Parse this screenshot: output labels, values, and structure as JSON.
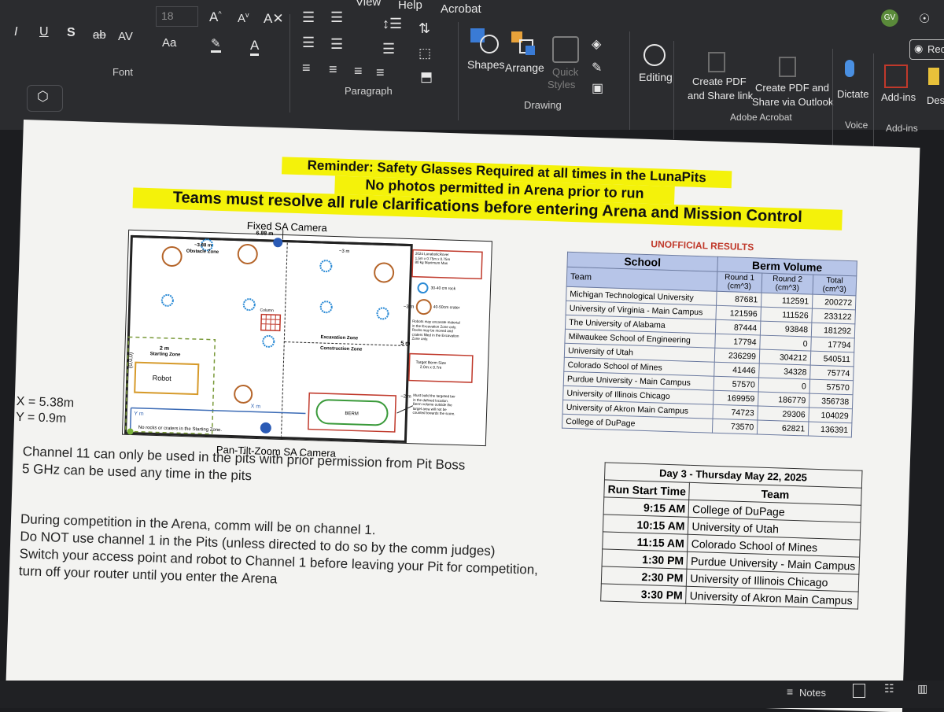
{
  "ribbon": {
    "font_size": "18",
    "menu_tabs": [
      "View",
      "Help",
      "Acrobat"
    ],
    "user_initials": "GV",
    "record_label": "Reco",
    "groups": {
      "font": "Font",
      "paragraph": "Paragraph",
      "drawing": "Drawing",
      "adobe": "Adobe Acrobat",
      "voice": "Voice",
      "addins": "Add-ins"
    },
    "buttons": {
      "shapes": "Shapes",
      "arrange": "Arrange",
      "quick_styles_1": "Quick",
      "quick_styles_2": "Styles",
      "editing": "Editing",
      "create_pdf_1": "Create PDF",
      "create_pdf_2": "and Share link",
      "create_pdf_outlook_1": "Create PDF and",
      "create_pdf_outlook_2": "Share via Outlook",
      "dictate": "Dictate",
      "addins": "Add-ins",
      "design": "Desi"
    }
  },
  "slide": {
    "reminder": "Reminder: Safety Glasses Required at all times in the LunaPits",
    "no_photos": "No photos permitted in Arena prior to run",
    "teams_must": "Teams must resolve all rule clarifications before entering Arena and Mission Control",
    "diagram": {
      "fixed_camera": "Fixed SA Camera",
      "ptz_camera": "Pan-Tilt-Zoom SA Camera",
      "width_label": "6.88 m",
      "obstacle_zone_dim": "~3.88 m",
      "obstacle_zone": "Obstacle Zone",
      "excavation_dim": "~3 m",
      "column": "Column",
      "excavation_zone": "Excavation Zone",
      "construction_zone": "Construction Zone",
      "starting_zone_dim": "2 m",
      "starting_zone": "Starting Zone",
      "robot": "Robot",
      "origin": "(0,0,0)",
      "xm": "X m",
      "ym": "Y m",
      "berm": "BERM",
      "no_rocks": "No rocks or craters in the Starting Zone.",
      "dim_3m": "~3 m",
      "dim_5m": "5 m",
      "dim_2m": "~2 m",
      "legend_rover": [
        "2024 LunaboticRover",
        "1.5m x 0.75m x 0.75m",
        "80 kg Maximum Mas"
      ],
      "legend_rock": "30-40 cm rock",
      "legend_crater": "40-50cm crater",
      "excavate_note": [
        "Robots may excavate material",
        "in the Excavation Zone only.",
        "Rocks may be moved and",
        "craters filled in the Excavation",
        "Zone only."
      ],
      "target_berm": [
        "Target Berm Size",
        "2.0m x 0.7m"
      ],
      "must_build": [
        "Must build the targeted ber",
        "in the defined location.",
        "Berm volume outside the",
        "target area will not be",
        "counted towards the score."
      ]
    },
    "x_readout": "X = 5.38m",
    "y_readout": "Y = 0.9m",
    "results_title": "UNOFFICIAL RESULTS",
    "results_table": {
      "school_header": "School",
      "berm_header": "Berm Volume",
      "team_header": "Team",
      "round1_header": [
        "Round 1",
        "(cm^3)"
      ],
      "round2_header": [
        "Round 2",
        "(cm^3)"
      ],
      "total_header": [
        "Total",
        "(cm^3)"
      ],
      "rows": [
        [
          "Michigan Technological University",
          "87681",
          "112591",
          "200272"
        ],
        [
          "University of Virginia - Main Campus",
          "121596",
          "111526",
          "233122"
        ],
        [
          "The University of Alabama",
          "87444",
          "93848",
          "181292"
        ],
        [
          "Milwaukee School of Engineering",
          "17794",
          "0",
          "17794"
        ],
        [
          "University of Utah",
          "236299",
          "304212",
          "540511"
        ],
        [
          "Colorado School of Mines",
          "41446",
          "34328",
          "75774"
        ],
        [
          "Purdue University - Main Campus",
          "57570",
          "0",
          "57570"
        ],
        [
          "University of Illinois Chicago",
          "169959",
          "186779",
          "356738"
        ],
        [
          "University of Akron Main Campus",
          "74723",
          "29306",
          "104029"
        ],
        [
          "College of DuPage",
          "73570",
          "62821",
          "136391"
        ]
      ]
    },
    "channel_note_1": "Channel 11 can only be used in the pits with prior permission from Pit Boss",
    "channel_note_2": "5 GHz can be used any time in the pits",
    "comm_note_1": "During competition in the Arena, comm will be on channel 1.",
    "comm_note_2": "Do NOT use channel 1 in the Pits (unless directed to do so by the comm judges)",
    "comm_note_3": "Switch your access point and robot to Channel 1 before leaving your Pit for competition,",
    "comm_note_4": "turn off your router until you enter the Arena",
    "schedule": {
      "title": "Day 3 - Thursday May 22, 2025",
      "time_header": "Run Start Time",
      "team_header": "Team",
      "rows": [
        [
          "9:15 AM",
          "College of DuPage"
        ],
        [
          "10:15 AM",
          "University of Utah"
        ],
        [
          "11:15 AM",
          "Colorado School of Mines"
        ],
        [
          "1:30 PM",
          "Purdue University - Main Campus"
        ],
        [
          "2:30 PM",
          "University of Illinois Chicago"
        ],
        [
          "3:30 PM",
          "University of Akron Main Campus"
        ]
      ]
    }
  },
  "statusbar": {
    "notes_label": "Notes"
  }
}
